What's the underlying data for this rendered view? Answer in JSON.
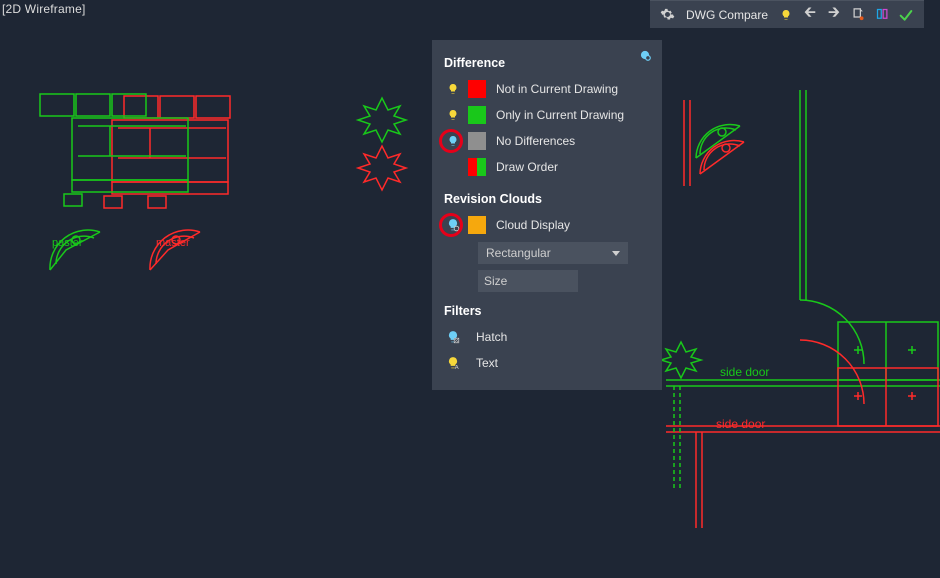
{
  "viewport_label": "[2D Wireframe]",
  "toolbar": {
    "title": "DWG Compare"
  },
  "panel": {
    "difference_title": "Difference",
    "difference": [
      {
        "label": "Not in Current Drawing",
        "color": "#ff0000"
      },
      {
        "label": "Only in Current Drawing",
        "color": "#19c81a"
      },
      {
        "label": "No Differences",
        "color": "#8f8f8f"
      },
      {
        "label": "Draw Order",
        "color_left": "#ff0000",
        "color_right": "#19c81a"
      }
    ],
    "clouds_title": "Revision Clouds",
    "cloud_display_label": "Cloud Display",
    "cloud_color": "#f6a80d",
    "cloud_shape": "Rectangular",
    "size_label": "Size",
    "filters_title": "Filters",
    "filters": [
      {
        "label": "Hatch"
      },
      {
        "label": "Text"
      }
    ]
  },
  "drawing_labels": {
    "master_left": "paster",
    "master_right": "master",
    "side_door_top": "side door",
    "side_door_bottom": "side door"
  }
}
